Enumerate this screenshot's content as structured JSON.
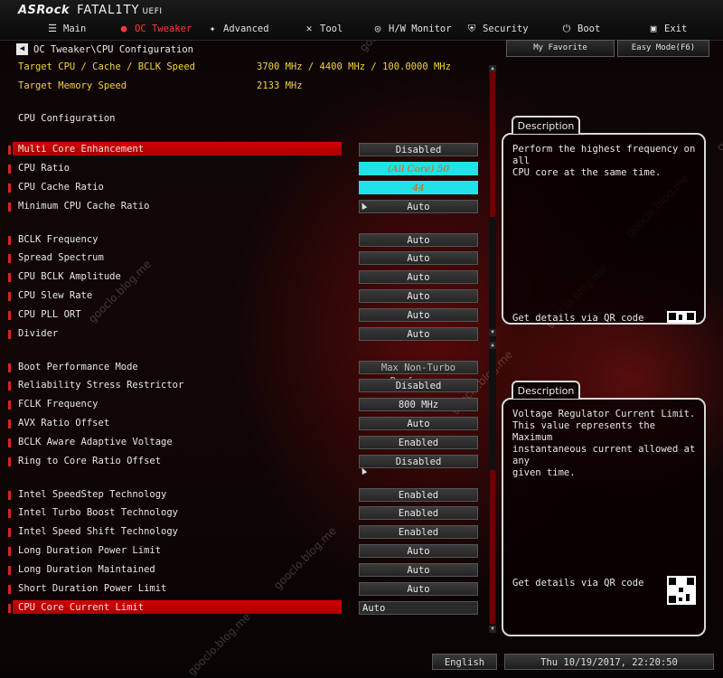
{
  "brand": {
    "name": "ASRock",
    "product": "FATAL1TY",
    "suffix": "UEFI"
  },
  "nav": [
    {
      "label": "Main",
      "icon": "list-icon"
    },
    {
      "label": "OC Tweaker",
      "icon": "flame-icon",
      "active": true
    },
    {
      "label": "Advanced",
      "icon": "star-icon"
    },
    {
      "label": "Tool",
      "icon": "wrench-icon"
    },
    {
      "label": "H/W Monitor",
      "icon": "globe-icon"
    },
    {
      "label": "Security",
      "icon": "shield-icon"
    },
    {
      "label": "Boot",
      "icon": "power-icon"
    },
    {
      "label": "Exit",
      "icon": "exit-icon"
    }
  ],
  "breadcrumb": "OC Tweaker\\CPU Configuration",
  "top_buttons": {
    "favorite": "My Favorite",
    "easy_mode": "Easy Mode(F6)"
  },
  "info": [
    {
      "label": "Target CPU / Cache / BCLK Speed",
      "value": "3700 MHz / 4400 MHz / 100.0000 MHz"
    },
    {
      "label": "Target Memory Speed",
      "value": "2133 MHz"
    }
  ],
  "section_title": "CPU Configuration",
  "settings": [
    {
      "label": "Multi Core Enhancement",
      "value": "Disabled"
    },
    {
      "label": "CPU Ratio",
      "value": "(All Core) 50"
    },
    {
      "label": "CPU Cache Ratio",
      "value": "44"
    },
    {
      "label": "Minimum CPU Cache Ratio",
      "value": "Auto"
    },
    {
      "label": "BCLK Frequency",
      "value": "Auto"
    },
    {
      "label": "Spread Spectrum",
      "value": "Auto"
    },
    {
      "label": "CPU BCLK Amplitude",
      "value": "Auto"
    },
    {
      "label": "CPU Slew Rate",
      "value": "Auto"
    },
    {
      "label": "CPU PLL ORT",
      "value": "Auto"
    },
    {
      "label": "Divider",
      "value": "Auto"
    },
    {
      "label": "Boot Performance Mode",
      "value": "Max Non-Turbo Perform..."
    },
    {
      "label": "Reliability Stress Restrictor",
      "value": "Disabled"
    },
    {
      "label": "FCLK Frequency",
      "value": "800 MHz"
    },
    {
      "label": "AVX Ratio Offset",
      "value": "Auto"
    },
    {
      "label": "BCLK Aware Adaptive Voltage",
      "value": "Enabled"
    },
    {
      "label": "Ring to Core Ratio Offset",
      "value": "Disabled"
    },
    {
      "label": "Intel SpeedStep Technology",
      "value": "Enabled"
    },
    {
      "label": "Intel Turbo Boost Technology",
      "value": "Enabled"
    },
    {
      "label": "Intel Speed Shift Technology",
      "value": "Enabled"
    },
    {
      "label": "Long Duration Power Limit",
      "value": "Auto"
    },
    {
      "label": "Long Duration Maintained",
      "value": "Auto"
    },
    {
      "label": "Short Duration Power Limit",
      "value": "Auto"
    },
    {
      "label": "CPU Core Current Limit",
      "value": "Auto"
    }
  ],
  "desc1": {
    "title": "Description",
    "text": "Perform the highest frequency on all\nCPU core at the same time.",
    "qr_label": "Get details via QR code"
  },
  "desc2": {
    "title": "Description",
    "text": "Voltage Regulator Current Limit.\nThis value represents the Maximum\ninstantaneous current allowed at any\ngiven time.",
    "qr_label": "Get details via QR code"
  },
  "footer": {
    "language": "English",
    "datetime": "Thu 10/19/2017, 22:20:50"
  },
  "watermark": "gooclo.blog.me",
  "colors": {
    "accent": "#d40000",
    "label_yellow": "#f2d23a",
    "cyan_field": "#1fe3e6"
  }
}
